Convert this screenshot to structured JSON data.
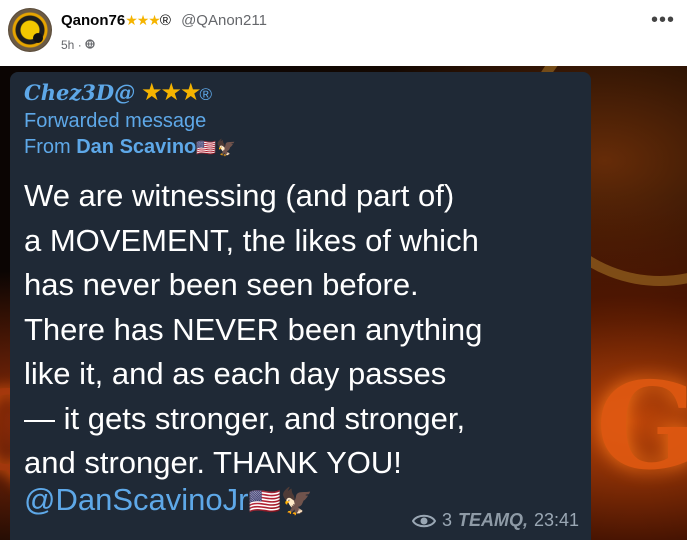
{
  "post": {
    "author": "Qanon76",
    "author_stars": "★★★",
    "author_reg": "®",
    "handle": "@QAnon211",
    "time": "5h",
    "separator": "·",
    "more_icon": "more-horizontal-icon",
    "more_label": "•••"
  },
  "telegram": {
    "sender_name": "Chez3D@",
    "sender_stars": "★★★",
    "sender_reg": "®",
    "forwarded_label": "Forwarded message",
    "from_prefix": "From",
    "from_name": "Dan Scavino",
    "from_flag": "🇺🇸",
    "from_eagle": "🦅",
    "message_lines": [
      "We are witnessing (and part of)",
      "a MOVEMENT, the likes of which",
      "has never been seen before.",
      "There has NEVER been anything",
      "like it, and as each day passes",
      "— it gets stronger, and stronger,",
      "and stronger. THANK YOU!"
    ],
    "mention": "@DanScavinoJr",
    "mention_flag": "🇺🇸",
    "mention_eagle": "🦅",
    "views": "3",
    "channel": "TEAMQ,",
    "timestamp": "23:41"
  },
  "colors": {
    "link_blue": "#5ea8e8",
    "bubble_bg": "#1f2936",
    "star_gold": "#f5b400"
  }
}
